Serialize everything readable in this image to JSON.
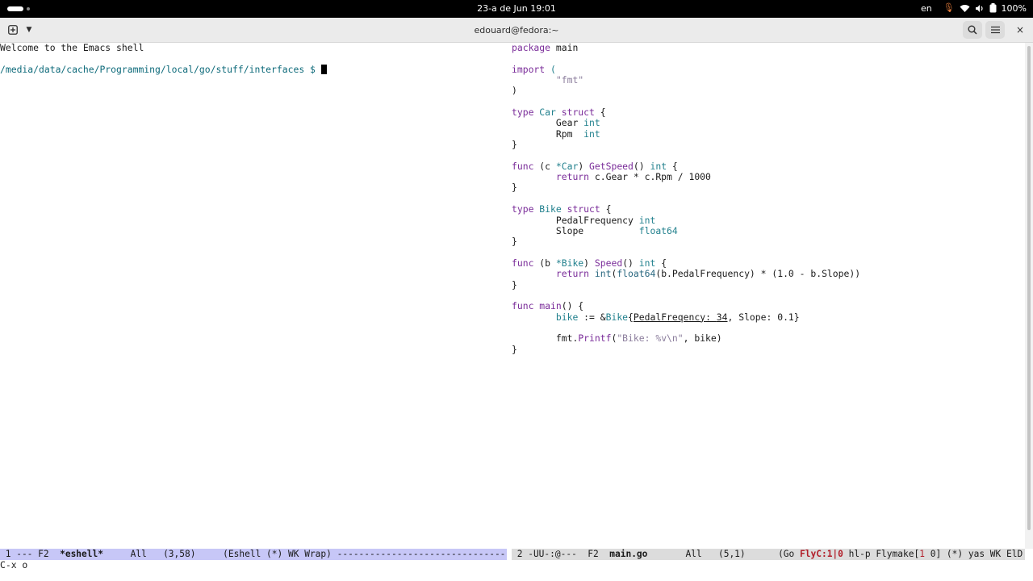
{
  "system_bar": {
    "datetime": "23-a de Jun  19:01",
    "keyboard_layout": "en",
    "battery_percent": "100%",
    "icons": [
      "activities-pill-icon",
      "microphone-icon",
      "wifi-icon",
      "volume-icon",
      "battery-icon"
    ]
  },
  "terminal": {
    "title": "edouard@fedora:~",
    "new_tab_icon": "new-tab-icon",
    "close_glyph": "×"
  },
  "eshell": {
    "welcome": "Welcome to the Emacs shell",
    "prompt": "/media/data/cache/Programming/local/go/stuff/interfaces $ "
  },
  "code": {
    "package": {
      "kw": "package",
      "name": " main"
    },
    "import": {
      "kw": "import",
      "open": " (",
      "path": "\"fmt\"",
      "close": ")"
    },
    "car": {
      "kw_type": "type",
      "name": "Car",
      "kw_struct": "struct",
      "brace": " {",
      "f1_name": "Gear",
      "f1_type": "int",
      "f2_name": "Rpm  ",
      "f2_type": "int",
      "end": "}"
    },
    "getspeed": {
      "kw": "func",
      "recv_open": " (c ",
      "recv_type": "*Car",
      "recv_close": ") ",
      "name": "GetSpeed",
      "params": "() ",
      "ret": "int",
      "brace": " {",
      "body_kw": "return",
      "body": " c.Gear * c.Rpm / 1000",
      "end": "}"
    },
    "bike": {
      "kw_type": "type",
      "name": "Bike",
      "kw_struct": "struct",
      "brace": " {",
      "f1_name": "PedalFrequency",
      "f1_type": "int",
      "f2_name": "Slope          ",
      "f2_type": "float64",
      "end": "}"
    },
    "speed": {
      "kw": "func",
      "recv_open": " (b ",
      "recv_type": "*Bike",
      "recv_close": ") ",
      "name": "Speed",
      "params": "() ",
      "ret": "int",
      "brace": " {",
      "body_kw": "return",
      "body_fn1": "int",
      "body_p1": "(",
      "body_fn2": "float64",
      "body_rest": "(b.PedalFrequency) * (1.0 - b.Slope))",
      "end": "}"
    },
    "main": {
      "kw": "func",
      "name": "main",
      "params": "() {",
      "var": "bike",
      "assign": " := &",
      "type": "Bike",
      "brace_open": "{",
      "ref_field": "PedalFreqency",
      "ref_sep": ": ",
      "ref_val": "34",
      "mid": ", Slope: 0.1}",
      "pkg": "fmt.",
      "call": "Printf",
      "paren": "(",
      "fmt_str": "\"Bike: %v\\n\"",
      "args": ", bike)",
      "end": "}"
    }
  },
  "modeline_left": {
    "prefix": " 1 --- F2  ",
    "buffer": "*eshell*",
    "position": "     All   (3,58)     ",
    "modes": "(Eshell (*) WK Wrap) ---------------------------------"
  },
  "modeline_right": {
    "prefix": " 2 -UU-:@---  F2  ",
    "buffer": "main.go",
    "position": "       All   (5,1)      ",
    "mode_go": "(Go ",
    "flyc": "FlyC:1|0",
    "hlp": " hl-p Flymake[",
    "fm_err": "1",
    "fm_sep": " ",
    "fm_warn": "0",
    "tail": "] (*) yas WK ElD"
  },
  "minibuffer": "C-x o"
}
